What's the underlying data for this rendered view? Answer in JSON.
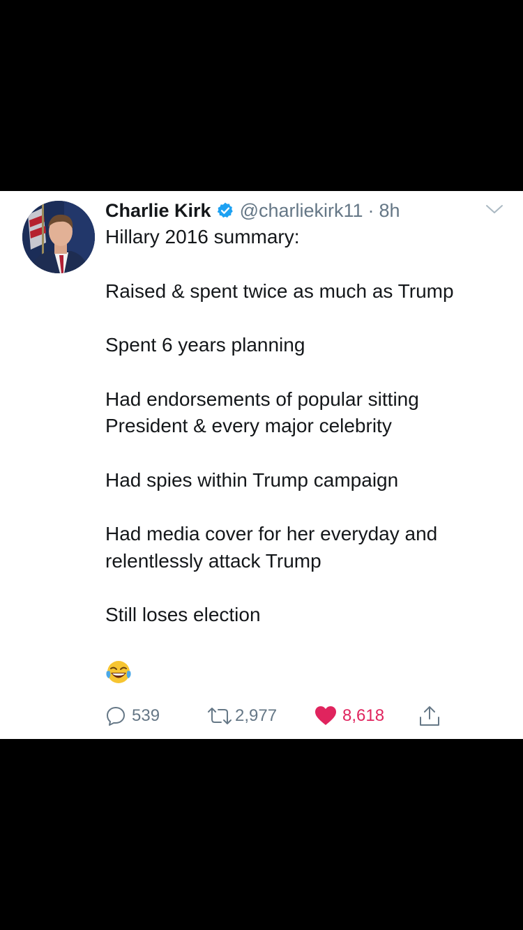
{
  "tweet": {
    "author": {
      "name": "Charlie Kirk",
      "handle": "@charliekirk11",
      "time": "8h",
      "verified": true
    },
    "text_paragraphs": [
      [
        "Hillary 2016 summary:"
      ],
      [
        "Raised & spent twice as much as Trump"
      ],
      [
        "Spent 6 years planning"
      ],
      [
        "Had endorsements of popular sitting",
        "President & every major celebrity"
      ],
      [
        "Had spies within Trump campaign"
      ],
      [
        "Had media cover for her everyday and",
        "relentlessly attack Trump"
      ],
      [
        "Still loses election"
      ]
    ],
    "emoji": "face-with-tears-of-joy",
    "actions": {
      "reply_count": "539",
      "retweet_count": "2,977",
      "like_count": "8,618",
      "liked": true
    }
  },
  "colors": {
    "text": "#14171a",
    "secondary": "#657786",
    "verified": "#1da1f2",
    "like": "#e0245e",
    "letterbox": "#000000"
  },
  "icons": {
    "verified": "verified-badge-icon",
    "chevron": "chevron-down-icon",
    "reply": "reply-icon",
    "retweet": "retweet-icon",
    "like": "heart-icon",
    "share": "share-icon"
  }
}
